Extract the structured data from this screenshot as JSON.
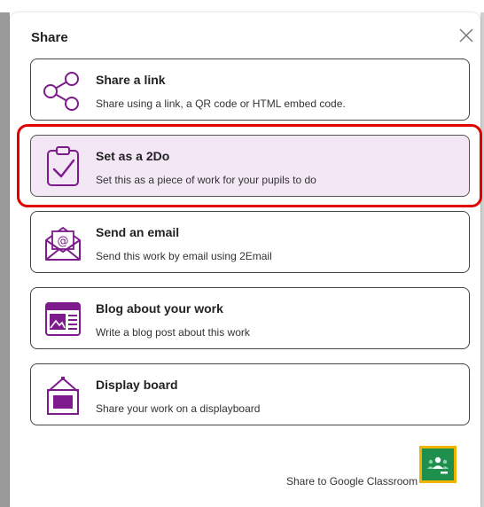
{
  "dialog": {
    "title": "Share",
    "close_icon": "close-icon"
  },
  "options": [
    {
      "title": "Share a link",
      "description": "Share using a link, a QR code or HTML embed code.",
      "icon": "share-icon"
    },
    {
      "title": "Set as a 2Do",
      "description": "Set this as a piece of work for your pupils to do",
      "icon": "clipboard-check-icon",
      "selected": true
    },
    {
      "title": "Send an email",
      "description": "Send this work by email using 2Email",
      "icon": "email-icon"
    },
    {
      "title": "Blog about your work",
      "description": "Write a blog post about this work",
      "icon": "blog-icon"
    },
    {
      "title": "Display board",
      "description": "Share your work on a displayboard",
      "icon": "display-board-icon"
    }
  ],
  "google_classroom": {
    "label": "Share to Google Classroom",
    "icon": "google-classroom-icon"
  },
  "colors": {
    "accent_purple": "#7d1a8c",
    "selected_bg": "#f3e7f6",
    "highlight_red": "#e00000",
    "classroom_green": "#1f8f4d",
    "classroom_border": "#f0b400"
  }
}
